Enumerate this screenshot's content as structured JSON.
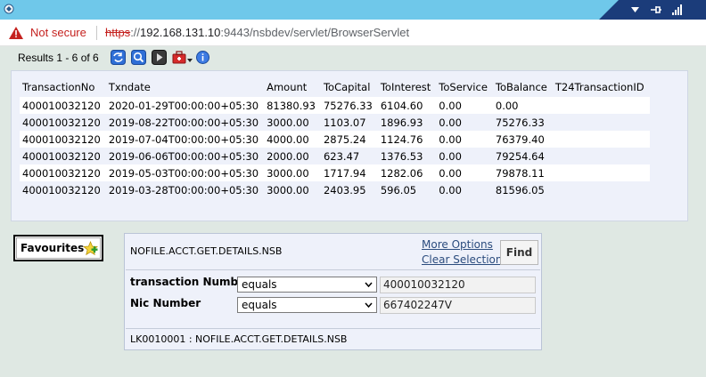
{
  "browser": {
    "security_label": "Not secure",
    "url_scheme": "https",
    "url_sep": "://",
    "url_host": "192.168.131.10",
    "url_rest": ":9443/nsbdev/servlet/BrowserServlet"
  },
  "toolbar": {
    "results_text": "Results 1 - 6 of 6"
  },
  "results": {
    "columns": [
      "TransactionNo",
      "Txndate",
      "Amount",
      "ToCapital",
      "ToInterest",
      "ToService",
      "ToBalance",
      "T24TransactionID"
    ],
    "rows": [
      [
        "400010032120",
        "2020-01-29T00:00:00+05:30",
        "81380.93",
        "75276.33",
        "6104.60",
        "0.00",
        "0.00",
        ""
      ],
      [
        "400010032120",
        "2019-08-22T00:00:00+05:30",
        "3000.00",
        "1103.07",
        "1896.93",
        "0.00",
        "75276.33",
        ""
      ],
      [
        "400010032120",
        "2019-07-04T00:00:00+05:30",
        "4000.00",
        "2875.24",
        "1124.76",
        "0.00",
        "76379.40",
        ""
      ],
      [
        "400010032120",
        "2019-06-06T00:00:00+05:30",
        "2000.00",
        "623.47",
        "1376.53",
        "0.00",
        "79254.64",
        ""
      ],
      [
        "400010032120",
        "2019-05-03T00:00:00+05:30",
        "3000.00",
        "1717.94",
        "1282.06",
        "0.00",
        "79878.11",
        ""
      ],
      [
        "400010032120",
        "2019-03-28T00:00:00+05:30",
        "3000.00",
        "2403.95",
        "596.05",
        "0.00",
        "81596.05",
        ""
      ]
    ]
  },
  "favourites": {
    "label": "Favourites"
  },
  "enquiry": {
    "name": "NOFILE.ACCT.GET.DETAILS.NSB",
    "more_options": "More Options",
    "clear_selection": "Clear Selection",
    "find_label": "Find",
    "fields": [
      {
        "label": "transaction Number",
        "operator": "equals",
        "value": "400010032120"
      },
      {
        "label": "Nic Number",
        "operator": "equals",
        "value": "667402247V"
      }
    ],
    "footer": "LK0010001 : NOFILE.ACCT.GET.DETAILS.NSB"
  },
  "colors": {
    "page_bg": "#dfe8e3",
    "titlebar": "#6fc8ea",
    "panel_bg": "#eef1fa",
    "link": "#2b4c7e",
    "warning_red": "#c5221f"
  }
}
